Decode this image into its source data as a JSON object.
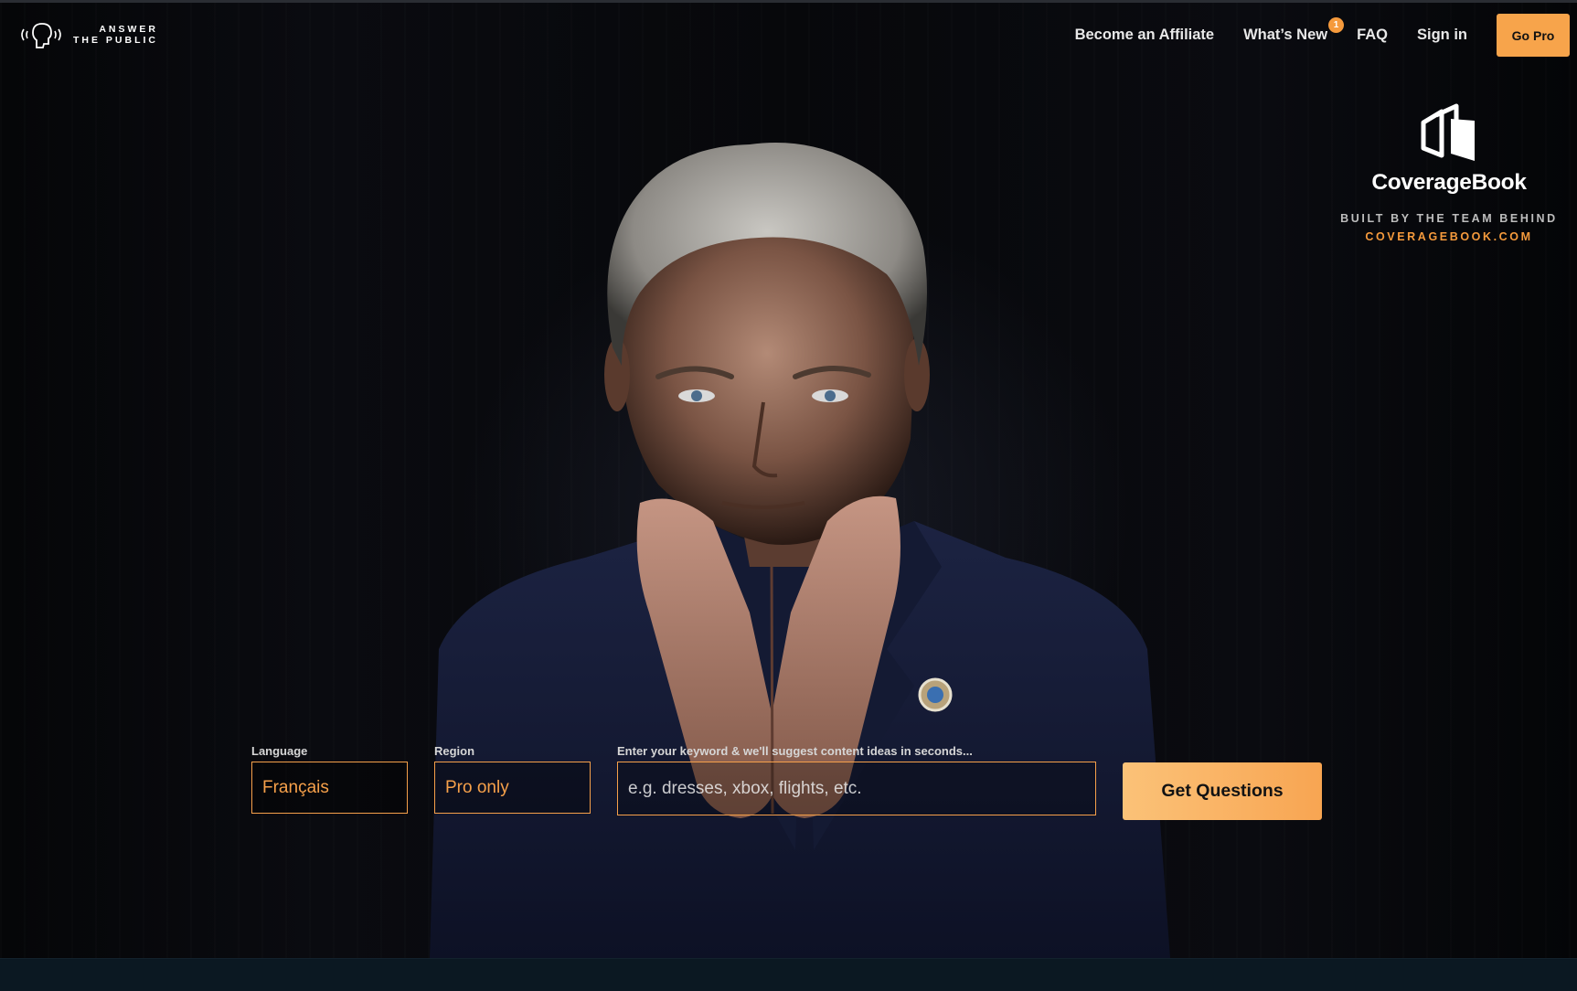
{
  "brand": {
    "logo_line1": "ANSWER",
    "logo_line2": "THE PUBLIC",
    "logo_icon": "speaking-head-icon"
  },
  "nav": {
    "affiliate": "Become an Affiliate",
    "whats_new": "What’s New",
    "whats_new_badge": "1",
    "faq": "FAQ",
    "sign_in": "Sign in",
    "go_pro": "Go Pro"
  },
  "sponsor": {
    "icon": "coveragebook-logo-icon",
    "name": "CoverageBook",
    "built_by": "BUILT BY THE TEAM BEHIND",
    "url": "COVERAGEBOOK.COM"
  },
  "hero_image": "man-in-navy-suit-with-pressed-hands",
  "search": {
    "language_label": "Language",
    "language_value": "Français",
    "region_label": "Region",
    "region_value": "Pro only",
    "keyword_label": "Enter your keyword & we'll suggest content ideas in seconds...",
    "keyword_placeholder": "e.g. dresses, xbox, flights, etc.",
    "submit_label": "Get Questions"
  },
  "colors": {
    "accent": "#f6a04a",
    "background": "#000000",
    "footer_band": "#0b1822"
  }
}
